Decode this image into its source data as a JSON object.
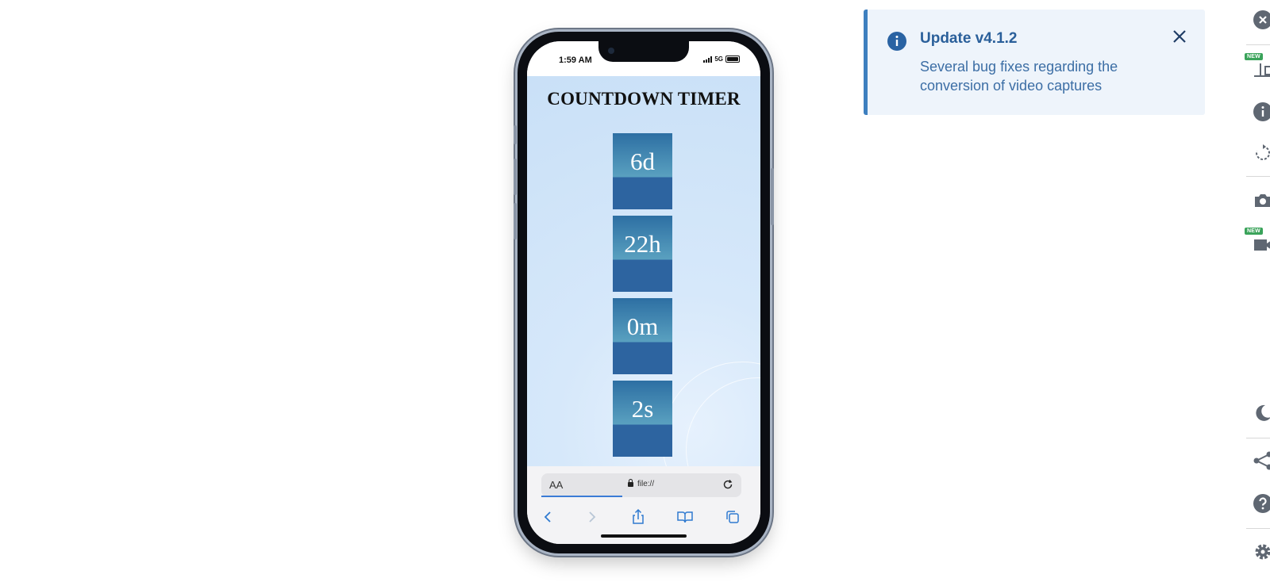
{
  "phone": {
    "status": {
      "time": "1:59 AM",
      "network": "5G"
    },
    "page": {
      "title": "COUNTDOWN TIMER",
      "timer": [
        {
          "value": "6d"
        },
        {
          "value": "22h"
        },
        {
          "value": "0m"
        },
        {
          "value": "2s"
        }
      ]
    },
    "browser": {
      "text_size_label": "AA",
      "url": "file://"
    }
  },
  "notification": {
    "title": "Update v4.1.2",
    "body": "Several bug fixes regarding the conversion of video captures",
    "accent_color": "#3d7fbf"
  },
  "toolbar": {
    "badges": {
      "new_label": "NEW"
    },
    "icons": [
      "close-circle-icon",
      "device-layout-icon",
      "info-icon",
      "rotate-icon",
      "camera-icon",
      "video-icon",
      "moon-icon",
      "share-icon",
      "help-icon",
      "gear-icon"
    ]
  }
}
